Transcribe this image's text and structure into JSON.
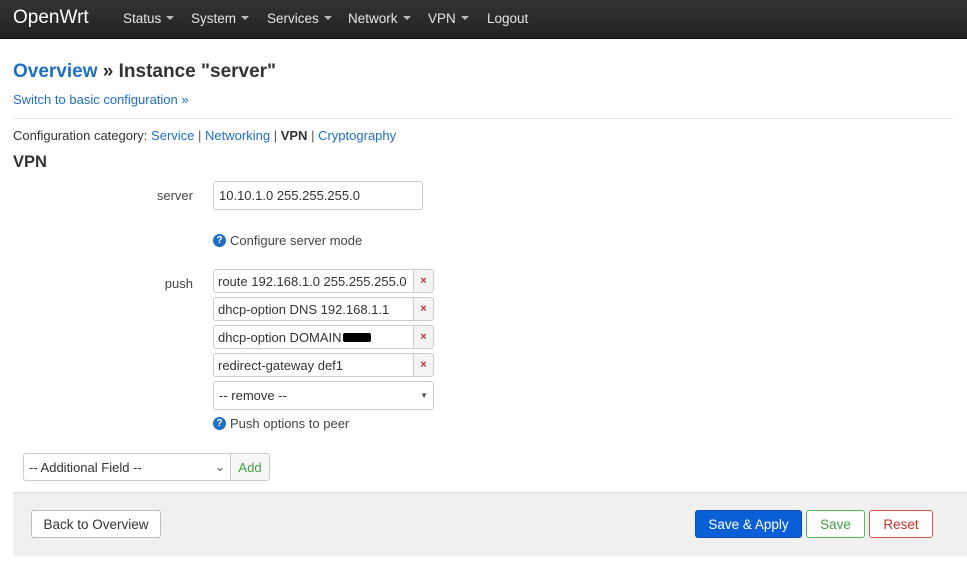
{
  "navbar": {
    "brand": "OpenWrt",
    "items": [
      {
        "label": "Status",
        "dropdown": true
      },
      {
        "label": "System",
        "dropdown": true
      },
      {
        "label": "Services",
        "dropdown": true
      },
      {
        "label": "Network",
        "dropdown": true
      },
      {
        "label": "VPN",
        "dropdown": true
      },
      {
        "label": "Logout",
        "dropdown": false
      }
    ]
  },
  "header": {
    "breadcrumb_root": "Overview",
    "breadcrumb_sep": " » ",
    "title": "Instance \"server\"",
    "basic_config_link": "Switch to basic configuration »"
  },
  "category": {
    "prefix": "Configuration category:",
    "items": [
      {
        "label": "Service",
        "active": false
      },
      {
        "label": "Networking",
        "active": false
      },
      {
        "label": "VPN",
        "active": true
      },
      {
        "label": "Cryptography",
        "active": false
      }
    ]
  },
  "section": {
    "title": "VPN",
    "server": {
      "label": "server",
      "value": "10.10.1.0 255.255.255.0",
      "help": "Configure server mode"
    },
    "push": {
      "label": "push",
      "values": [
        "route 192.168.1.0 255.255.255.0",
        "dhcp-option DNS 192.168.1.1",
        "dhcp-option DOMAIN",
        "redirect-gateway def1"
      ],
      "remove_symbol": "×",
      "remove_select": "-- remove --",
      "help": "Push options to peer"
    },
    "additional_field": {
      "select": "-- Additional Field --",
      "add_label": "Add"
    }
  },
  "footer": {
    "back": "Back to Overview",
    "save_apply": "Save & Apply",
    "save": "Save",
    "reset": "Reset"
  },
  "colors": {
    "navbar_bg": "#222222",
    "link": "#1f6fc5",
    "primary": "#0a5fd6",
    "success": "#449d44",
    "danger": "#c9302c"
  },
  "icons": {
    "help": "question-circle-icon",
    "remove": "close-icon",
    "dropdown": "caret-down-icon"
  }
}
